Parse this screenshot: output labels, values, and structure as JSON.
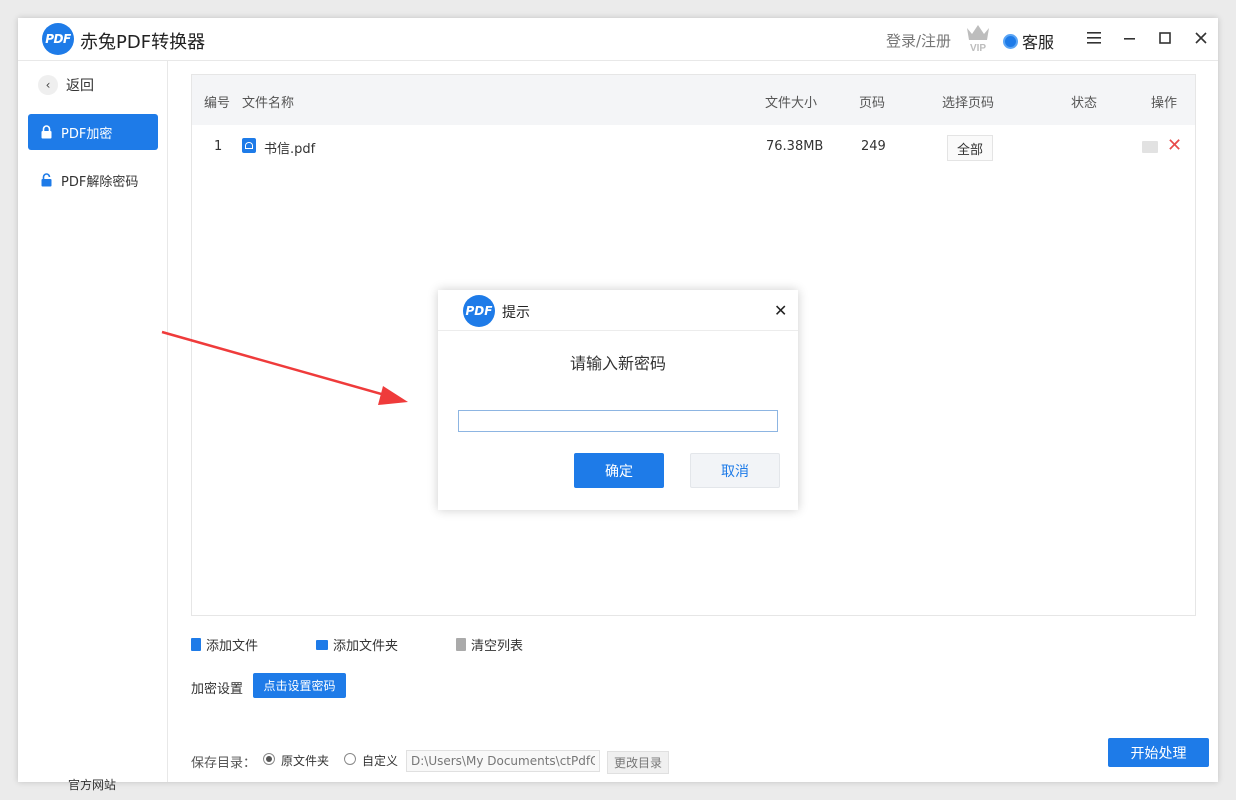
{
  "app": {
    "logo_text": "PDF",
    "title": "赤兔PDF转换器",
    "login_label": "登录/注册",
    "vip_label": "VIP",
    "service_label": "客服",
    "accent_color": "#1e7be8"
  },
  "sidebar": {
    "back_label": "返回",
    "items": [
      {
        "label": "PDF加密",
        "icon": "lock-icon",
        "active": true
      },
      {
        "label": "PDF解除密码",
        "icon": "unlock-icon",
        "active": false
      }
    ],
    "footer_label": "官方网站"
  },
  "table": {
    "headers": [
      "编号",
      "文件名称",
      "文件大小",
      "页码",
      "选择页码",
      "状态",
      "操作"
    ],
    "rows": [
      {
        "index": "1",
        "name": "书信.pdf",
        "size": "76.38MB",
        "pages": "249",
        "page_select": "全部",
        "status": ""
      }
    ]
  },
  "toolbar": {
    "add_file": "添加文件",
    "add_folder": "添加文件夹",
    "clear_list": "清空列表",
    "encrypt_label": "加密设置",
    "set_password_button": "点击设置密码"
  },
  "save": {
    "label": "保存目录：",
    "option_original": "原文件夹",
    "option_custom": "自定义",
    "selected": "原文件夹",
    "path_value": "D:\\Users\\My Documents\\ctPdfCon",
    "change_dir": "更改目录"
  },
  "start_button": "开始处理",
  "dialog": {
    "logo_text": "PDF",
    "title": "提示",
    "message": "请输入新密码",
    "input_value": "",
    "ok_label": "确定",
    "cancel_label": "取消"
  }
}
